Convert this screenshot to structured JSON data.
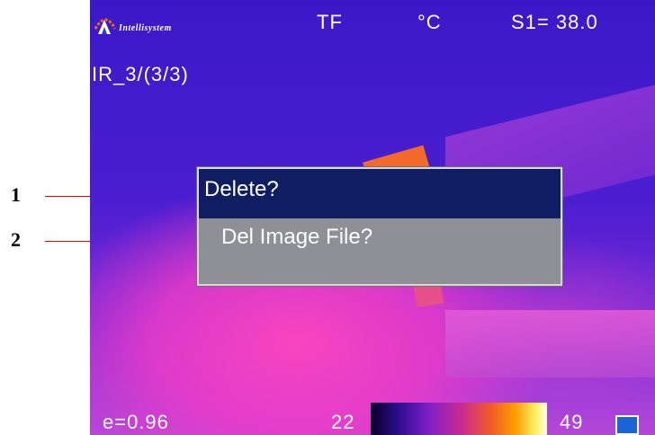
{
  "callouts": [
    {
      "number": "1"
    },
    {
      "number": "2"
    }
  ],
  "camera": {
    "brand": "Intellisystem",
    "mode": "TF",
    "unit": "°C",
    "spot_readout": "S1= 38.0",
    "file_label": "IR_3/(3/3)",
    "emissivity": "e=0.96",
    "scale_min": "22",
    "scale_max": "49"
  },
  "dialog": {
    "title": "Delete?",
    "message": "Del Image File?"
  },
  "colors": {
    "dialog_title_bg": "#0f1d62",
    "dialog_body_bg": "#8e9095",
    "callout_line": "#e00000",
    "palette_indicator": "#1a64d8"
  },
  "icons": {
    "logo": "brand-logo-icon",
    "palette": "palette-indicator-icon"
  }
}
